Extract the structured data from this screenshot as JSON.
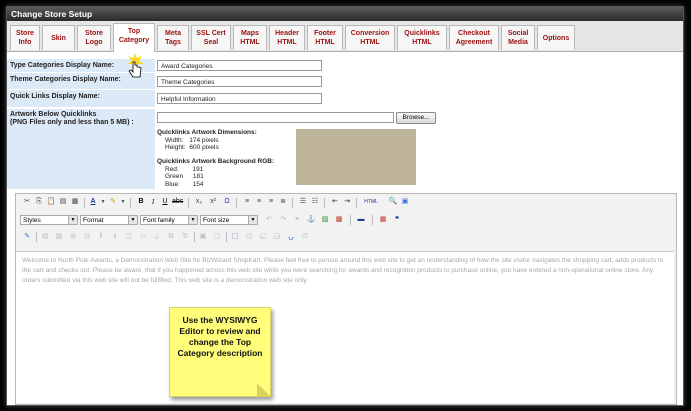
{
  "window": {
    "title": "Change Store Setup"
  },
  "tabs": [
    {
      "l1": "Store",
      "l2": "Info",
      "active": false
    },
    {
      "l1": "Skin",
      "l2": "",
      "active": false
    },
    {
      "l1": "Store",
      "l2": "Logo",
      "active": false
    },
    {
      "l1": "Top",
      "l2": "Category",
      "active": true
    },
    {
      "l1": "Meta",
      "l2": "Tags",
      "active": false
    },
    {
      "l1": "SSL Cert",
      "l2": "Seal",
      "active": false
    },
    {
      "l1": "Maps",
      "l2": "HTML",
      "active": false
    },
    {
      "l1": "Header",
      "l2": "HTML",
      "active": false
    },
    {
      "l1": "Footer",
      "l2": "HTML",
      "active": false
    },
    {
      "l1": "Conversion",
      "l2": "HTML",
      "active": false
    },
    {
      "l1": "Quicklinks",
      "l2": "HTML",
      "active": false
    },
    {
      "l1": "Checkout",
      "l2": "Agreement",
      "active": false
    },
    {
      "l1": "Social",
      "l2": "Media",
      "active": false
    },
    {
      "l1": "Options",
      "l2": "",
      "active": false
    }
  ],
  "form": {
    "type_cat_label": "Type Categories Display Name:",
    "type_cat_value": "Award Categories",
    "theme_cat_label": "Theme Categories Display Name:",
    "theme_cat_value": "Theme Categories",
    "quick_links_label": "Quick Links Display Name:",
    "quick_links_value": "Helpful Information",
    "artwork_label_1": "Artwork Below Quicklinks",
    "artwork_label_2": "(PNG Files only and less than 5 MB) :",
    "file_value": "",
    "browse_label": "Browse...",
    "dims_title": "Quicklinks Artwork Dimensions:",
    "width_label": "Width:",
    "width_value": "174 pixels",
    "height_label": "Height:",
    "height_value": "600 pixels",
    "rgb_title": "Quicklinks Artwork Background RGB:",
    "red_label": "Red:",
    "red_value": "191",
    "green_label": "Green",
    "green_value": "181",
    "blue_label": "Blue:",
    "blue_value": "154",
    "swatch_color": "#bfb59a"
  },
  "editor": {
    "styles": "Styles",
    "format": "Format",
    "font_family": "Font family",
    "font_size": "Font size",
    "content": "Welcome to North Pole Awards, a Demonstration Web Site for BizWizard ShopKart. Please feel free to peruse around this web site to get an understanding of how the site visitor navigates the shopping cart, adds products to the cart and checks out. Please be aware, that if you happened across this web site while you were searching for awards and recognition products to purchase online, you have entered a non-operational online store. Any orders submitted via this web site will not be fulfilled. This web site is a demonstration web site only."
  },
  "note": {
    "text": "Use the WYSIWYG Editor to review and change the Top Category description"
  },
  "colors": {
    "tab_text": "#9a1010",
    "label_bg": "#dce9f7",
    "note_bg": "#fffd7a"
  }
}
